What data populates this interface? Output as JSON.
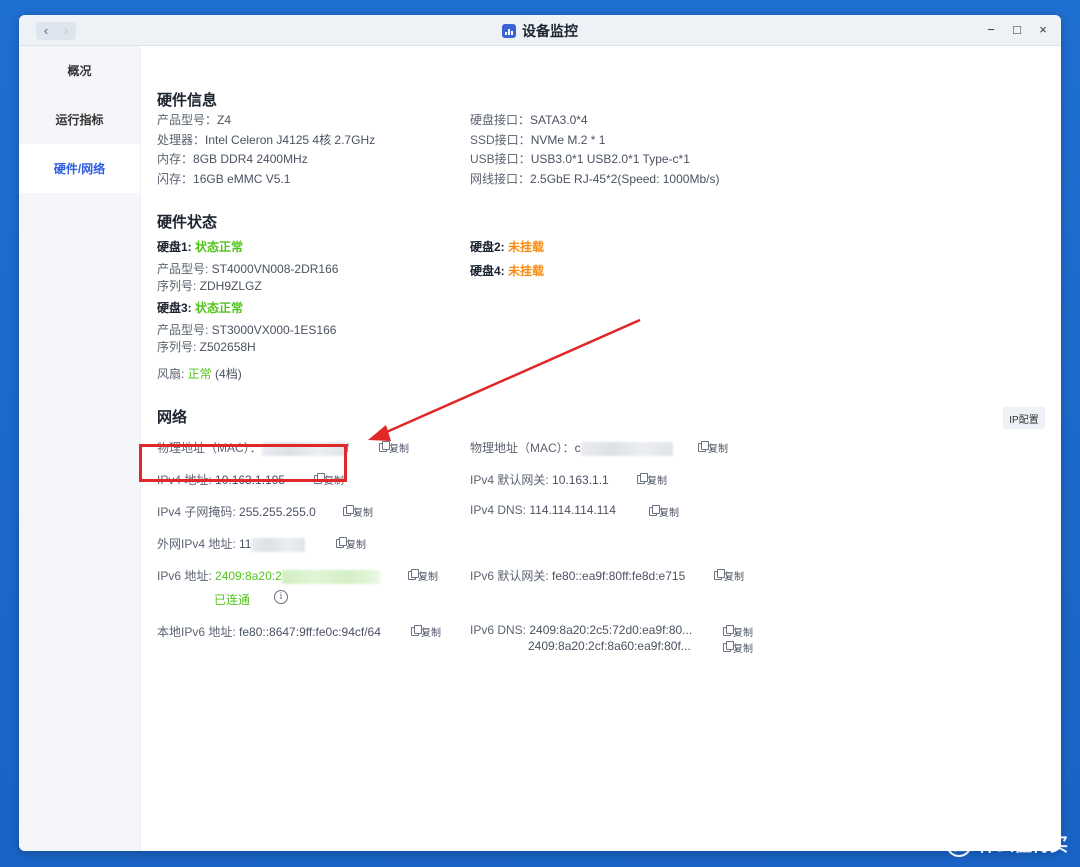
{
  "window": {
    "title": "设备监控",
    "nav_back": "‹",
    "nav_forward": "›",
    "controls": {
      "minimize": "−",
      "maximize": "□",
      "close": "×"
    }
  },
  "sidebar": {
    "items": [
      {
        "label": "概况"
      },
      {
        "label": "运行指标"
      },
      {
        "label": "硬件/网络"
      }
    ]
  },
  "hardware_info": {
    "heading": "硬件信息",
    "left": [
      {
        "label": "产品型号：",
        "value": "Z4"
      },
      {
        "label": "处理器：",
        "value": "Intel Celeron J4125 4核 2.7GHz"
      },
      {
        "label": "内存：",
        "value": "8GB DDR4 2400MHz"
      },
      {
        "label": "闪存：",
        "value": "16GB eMMC V5.1"
      }
    ],
    "right": [
      {
        "label": "硬盘接口：",
        "value": "SATA3.0*4"
      },
      {
        "label": "SSD接口：",
        "value": "NVMe M.2 * 1"
      },
      {
        "label": "USB接口：",
        "value": "USB3.0*1 USB2.0*1 Type-c*1"
      },
      {
        "label": "网线接口：",
        "value": "2.5GbE RJ-45*2(Speed: 1000Mb/s)"
      }
    ]
  },
  "hardware_status": {
    "heading": "硬件状态",
    "disk1": {
      "label": "硬盘1: ",
      "status": "状态正常",
      "model_label": "产品型号: ",
      "model": "ST4000VN008-2DR166",
      "serial_label": "序列号: ",
      "serial": "ZDH9ZLGZ"
    },
    "disk2": {
      "label": "硬盘2: ",
      "status": "未挂载"
    },
    "disk3": {
      "label": "硬盘3: ",
      "status": "状态正常",
      "model_label": "产品型号: ",
      "model": "ST3000VX000-1ES166",
      "serial_label": "序列号: ",
      "serial": "Z502658H"
    },
    "disk4": {
      "label": "硬盘4: ",
      "status": "未挂载"
    },
    "fan": {
      "label": "风扇: ",
      "status": "正常",
      "level": " (4档)"
    }
  },
  "network": {
    "heading": "网络",
    "ip_config_button": "IP配置",
    "copy_label": "复制",
    "mac1": {
      "label": "物理地址（MAC）：",
      "visible_tail": "f"
    },
    "mac2": {
      "label": "物理地址（MAC）：",
      "visible_head": "c"
    },
    "ipv4": {
      "label": "IPv4 地址: ",
      "value": "10.163.1.195"
    },
    "ipv4_gateway": {
      "label": "IPv4 默认网关: ",
      "value": "10.163.1.1"
    },
    "ipv4_mask": {
      "label": "IPv4 子网掩码: ",
      "value": "255.255.255.0"
    },
    "ipv4_dns": {
      "label": "IPv4 DNS: ",
      "value": "114.114.114.114"
    },
    "wan_ipv4": {
      "label": "外网IPv4 地址: ",
      "visible_head": "11"
    },
    "ipv6": {
      "label": "IPv6 地址: ",
      "visible_head": "2409:8a20:2",
      "connected": "已连通",
      "info": "i"
    },
    "ipv6_gateway": {
      "label": "IPv6 默认网关: ",
      "value": "fe80::ea9f:80ff:fe8d:e715"
    },
    "local_ipv6": {
      "label": "本地IPv6 地址: ",
      "value": "fe80::8647:9ff:fe0c:94cf/64"
    },
    "ipv6_dns": {
      "label": "IPv6 DNS: ",
      "value1": "2409:8a20:2c5:72d0:ea9f:80...",
      "value2": "2409:8a20:2cf:8a60:ea9f:80f..."
    }
  },
  "watermark": {
    "text": "什么值得买",
    "icon": "值"
  },
  "colors": {
    "accent": "#2f5fe0",
    "ok": "#52c41a",
    "warn": "#fa8c16",
    "annotation": "#e02828",
    "desktop": "#1f6fd1"
  }
}
